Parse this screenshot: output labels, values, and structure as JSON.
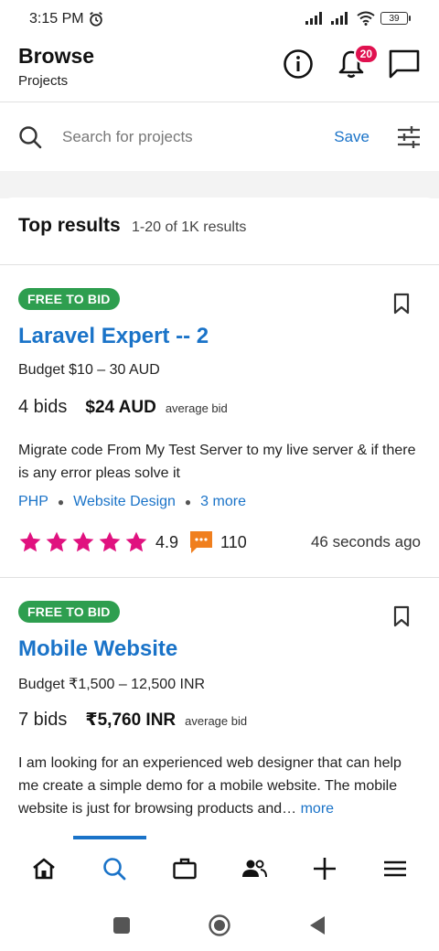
{
  "status": {
    "time": "3:15 PM",
    "battery": "39"
  },
  "header": {
    "title": "Browse",
    "subtitle": "Projects",
    "notifications_count": "20"
  },
  "search": {
    "placeholder": "Search for projects",
    "save_label": "Save"
  },
  "results": {
    "title": "Top results",
    "count": "1-20 of 1K results"
  },
  "projects": [
    {
      "badge": "FREE TO BID",
      "title": "Laravel Expert -- 2",
      "budget": "Budget $10 – 30 AUD",
      "bids": "4 bids",
      "avg_amount": "$24 AUD",
      "avg_label": "average bid",
      "description": "Migrate code From My Test Server to my live server & if there is any error pleas solve it",
      "tags": [
        "PHP",
        "Website Design",
        "3 more"
      ],
      "rating": "4.9",
      "stars": 5,
      "reviews": "110",
      "posted": "46 seconds ago"
    },
    {
      "badge": "FREE TO BID",
      "title": "Mobile Website",
      "budget": "Budget ₹1,500 – 12,500 INR",
      "bids": "7 bids",
      "avg_amount": "₹5,760 INR",
      "avg_label": "average bid",
      "description": "I am looking for an experienced web designer that can help me create a simple demo for a mobile website. The mobile website is just for browsing products and…",
      "more": "more"
    }
  ],
  "colors": {
    "accent": "#1a73c8",
    "badge_green": "#2e9e4f",
    "star_pink": "#e0117f",
    "notif_red": "#e0114f"
  },
  "bottom_nav": [
    "home-icon",
    "search-icon",
    "briefcase-icon",
    "people-icon",
    "plus-icon",
    "menu-icon"
  ],
  "active_nav": "search-icon"
}
